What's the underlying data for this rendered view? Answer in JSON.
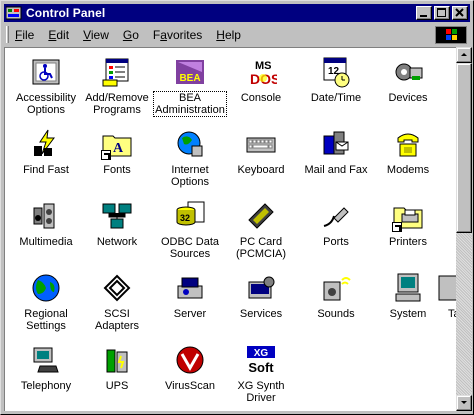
{
  "window": {
    "title": "Control Panel"
  },
  "menubar": {
    "items": [
      {
        "label": "File",
        "underline": "F",
        "rest": "ile"
      },
      {
        "label": "Edit",
        "underline": "E",
        "rest": "dit"
      },
      {
        "label": "View",
        "underline": "V",
        "rest": "iew"
      },
      {
        "label": "Go",
        "underline": "G",
        "rest": "o"
      },
      {
        "label": "Favorites",
        "underline": "a",
        "pre": "F",
        "rest": "vorites"
      },
      {
        "label": "Help",
        "underline": "H",
        "rest": "elp"
      }
    ]
  },
  "items": [
    {
      "label": "Accessibility\nOptions",
      "icon": "accessibility-icon"
    },
    {
      "label": "Add/Remove\nPrograms",
      "icon": "add-remove-programs-icon"
    },
    {
      "label": "BEA\nAdministration",
      "icon": "bea-icon",
      "selected": true
    },
    {
      "label": "Console",
      "icon": "msdos-icon"
    },
    {
      "label": "Date/Time",
      "icon": "calendar-clock-icon"
    },
    {
      "label": "Devices",
      "icon": "devices-icon"
    },
    {
      "label": "Find Fast",
      "icon": "find-fast-icon"
    },
    {
      "label": "Fonts",
      "icon": "fonts-folder-icon"
    },
    {
      "label": "Internet\nOptions",
      "icon": "internet-globe-icon"
    },
    {
      "label": "Keyboard",
      "icon": "keyboard-icon"
    },
    {
      "label": "Mail and Fax",
      "icon": "mail-fax-icon"
    },
    {
      "label": "Modems",
      "icon": "modem-phone-icon"
    },
    {
      "label": "Multimedia",
      "icon": "multimedia-icon"
    },
    {
      "label": "Network",
      "icon": "network-icon"
    },
    {
      "label": "ODBC Data\nSources",
      "icon": "odbc-icon"
    },
    {
      "label": "PC Card\n(PCMCIA)",
      "icon": "pc-card-icon"
    },
    {
      "label": "Ports",
      "icon": "ports-icon"
    },
    {
      "label": "Printers",
      "icon": "printers-folder-icon"
    },
    {
      "label": "Regional\nSettings",
      "icon": "globe-icon"
    },
    {
      "label": "SCSI Adapters",
      "icon": "scsi-icon"
    },
    {
      "label": "Server",
      "icon": "server-icon"
    },
    {
      "label": "Services",
      "icon": "services-icon"
    },
    {
      "label": "Sounds",
      "icon": "speaker-icon"
    },
    {
      "label": "System",
      "icon": "computer-icon"
    },
    {
      "label": "Telephony",
      "icon": "telephony-icon"
    },
    {
      "label": "UPS",
      "icon": "ups-battery-icon"
    },
    {
      "label": "VirusScan",
      "icon": "virusscan-icon"
    },
    {
      "label": "XG Synth\nDriver",
      "icon": "xg-soft-icon"
    },
    {
      "label": "Ta",
      "icon": "partial-icon"
    }
  ],
  "colors": {
    "titlebar": "#000080",
    "face": "#c0c0c0",
    "content": "#ffffff"
  }
}
